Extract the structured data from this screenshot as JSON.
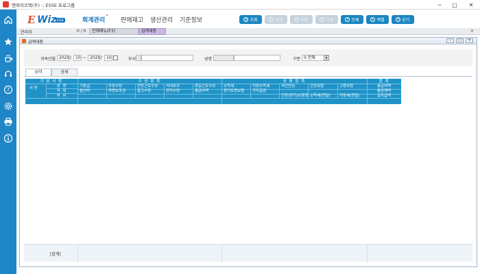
{
  "window": {
    "title": "엔와이즈텍(주) :: ESSE 프로그램",
    "minimize": "─",
    "maximize": "□",
    "close": "✕"
  },
  "logo": {
    "e": "E",
    "wiz": "Wiz",
    "badge": "ESSE"
  },
  "menu": [
    "회계관리",
    "판매재고",
    "생산관리",
    "기준정보"
  ],
  "toolbar": [
    {
      "label": "조회",
      "glyph": "◎",
      "enabled": true
    },
    {
      "label": "입력",
      "glyph": "i",
      "enabled": false
    },
    {
      "label": "저장",
      "glyph": "s",
      "enabled": false
    },
    {
      "label": "삭제",
      "glyph": "d",
      "enabled": false
    },
    {
      "label": "인쇄",
      "glyph": "P",
      "enabled": true
    },
    {
      "label": "엑셀",
      "glyph": "E",
      "enabled": true
    },
    {
      "label": "닫기",
      "glyph": "X",
      "enabled": true
    }
  ],
  "tabstrip": {
    "user": "관리자",
    "count": "0 / 0",
    "tab1": "전체메뉴(F3)",
    "tab2": "급여대장",
    "close": "✕"
  },
  "inner": {
    "title": "급여대장"
  },
  "search": {
    "period_label": "귀속년월",
    "from_year": "2020",
    "from_month": "10",
    "tilde": "~",
    "to_year": "2020",
    "to_month": "10",
    "dept_label": "부서",
    "name_label": "성명",
    "type_label": "구분",
    "type_value": "0.전체"
  },
  "subtabs": [
    "요약",
    "상세"
  ],
  "grid": {
    "group_basic": "기 본 사 항",
    "group_pay": "수 당 항 목",
    "group_deduct": "공 제 항 목",
    "group_total": "합 계",
    "emp_no": "사 번",
    "basic_rows": [
      "성 명",
      "직 위",
      "부 서"
    ],
    "pay_row1": [
      "기본급",
      "주휴수당",
      "연장근로수당",
      "식대보조",
      "휴일근로수당"
    ],
    "pay_row2": [
      "월선비",
      "자량보조금",
      "출고수당",
      "당직수당",
      "총급여액"
    ],
    "deduct_row1": [
      "소득세",
      "지방소득세",
      "국민연금",
      "건강보험",
      "고용보험"
    ],
    "deduct_row2": [
      "장기요양보험",
      "가지급금"
    ],
    "deduct_row3": [
      "건강(장기)보험정산",
      "소득세(연말)",
      "지방세(연말)"
    ],
    "total_rows": [
      "총급여액",
      "총공제액",
      "실지급액"
    ]
  },
  "footer": {
    "sum_label": "[합계]"
  }
}
